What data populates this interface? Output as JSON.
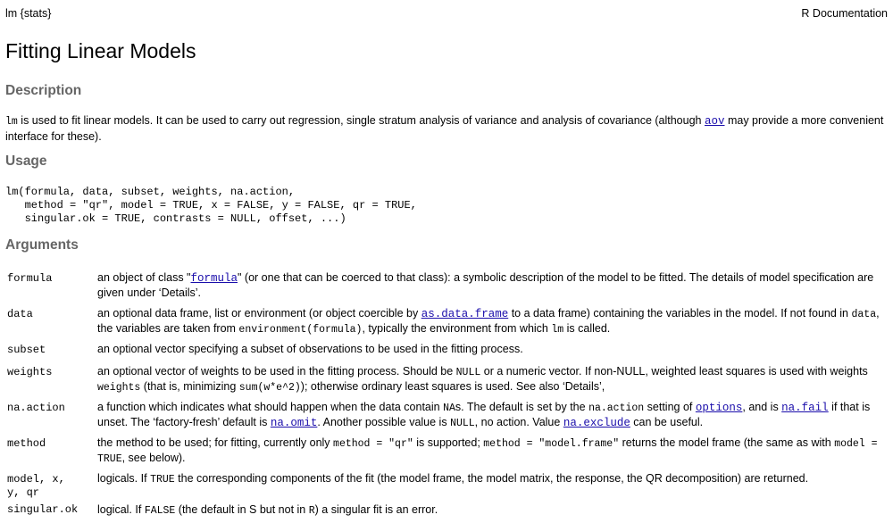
{
  "header": {
    "left": "lm {stats}",
    "right": "R Documentation"
  },
  "title": "Fitting Linear Models",
  "sections": {
    "description": "Description",
    "usage": "Usage",
    "arguments": "Arguments"
  },
  "description": {
    "code_lm": "lm",
    "text_1": " is used to fit linear models. It can be used to carry out regression, single stratum analysis of variance and analysis of covariance (although ",
    "link_aov": "aov",
    "text_2": " may provide a more convenient interface for these)."
  },
  "usage": {
    "line1": "lm(formula, data, subset, weights, na.action,",
    "line2": "   method = \"qr\", model = TRUE, x = FALSE, y = FALSE, qr = TRUE,",
    "line3": "   singular.ok = TRUE, contrasts = NULL, offset, ...)"
  },
  "args": {
    "formula": {
      "name": "formula",
      "t1": "an object of class \"",
      "link": "formula",
      "t2": "\" (or one that can be coerced to that class): a symbolic description of the model to be fitted. The details of model specification are given under ‘Details’."
    },
    "data": {
      "name": "data",
      "t1": "an optional data frame, list or environment (or object coercible by ",
      "link": "as.data.frame",
      "t2": " to a data frame) containing the variables in the model. If not found in ",
      "c1": "data",
      "t3": ", the variables are taken from ",
      "c2": "environment(formula)",
      "t4": ", typically the environment from which ",
      "c3": "lm",
      "t5": " is called."
    },
    "subset": {
      "name": "subset",
      "t1": "an optional vector specifying a subset of observations to be used in the fitting process."
    },
    "weights": {
      "name": "weights",
      "t1": "an optional vector of weights to be used in the fitting process. Should be ",
      "c1": "NULL",
      "t2": " or a numeric vector. If non-NULL, weighted least squares is used with weights ",
      "c2": "weights",
      "t3": " (that is, minimizing ",
      "c3": "sum(w*e^2)",
      "t4": "); otherwise ordinary least squares is used. See also ‘Details’,"
    },
    "na_action": {
      "name": "na.action",
      "t1": "a function which indicates what should happen when the data contain ",
      "c1": "NA",
      "t2": "s. The default is set by the ",
      "c2": "na.action",
      "t3": " setting of ",
      "link1": "options",
      "t4": ", and is ",
      "link2": "na.fail",
      "t5": " if that is unset. The ‘factory-fresh’ default is ",
      "link3": "na.omit",
      "t6": ". Another possible value is ",
      "c3": "NULL",
      "t7": ", no action. Value ",
      "link4": "na.exclude",
      "t8": " can be useful."
    },
    "method": {
      "name": "method",
      "t1": "the method to be used; for fitting, currently only ",
      "c1": "method = \"qr\"",
      "t2": " is supported; ",
      "c2": "method = \"model.frame\"",
      "t3": " returns the model frame (the same as with ",
      "c3": "model = TRUE",
      "t4": ", see below)."
    },
    "model": {
      "name1": "model, x,",
      "name2": "y, qr",
      "t1": "logicals. If ",
      "c1": "TRUE",
      "t2": " the corresponding components of the fit (the model frame, the model matrix, the response, the QR decomposition) are returned."
    },
    "singular": {
      "name": "singular.ok",
      "t1": "logical. If ",
      "c1": "FALSE",
      "t2": " (the default in S but not in ",
      "c2": "R",
      "t3": ") a singular fit is an error."
    }
  }
}
